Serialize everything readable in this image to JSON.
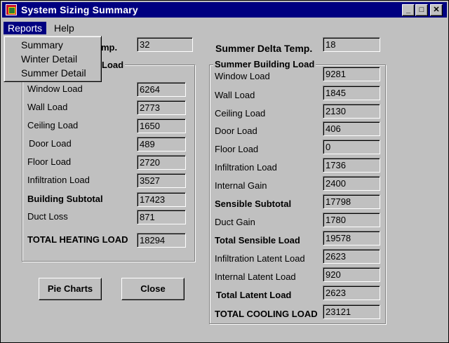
{
  "window": {
    "title": "System Sizing Summary",
    "min_glyph": "_",
    "max_glyph": "□",
    "close_glyph": "✕"
  },
  "menu": {
    "reports": "Reports",
    "help": "Help",
    "dropdown": [
      "Summary",
      "Winter Detail",
      "Summer Detail"
    ]
  },
  "winter": {
    "delta_label_visible": "mp.",
    "delta_value": "32",
    "group_title_visible": "Load",
    "rows": [
      {
        "label": "Window Load",
        "value": "6264",
        "bold": false
      },
      {
        "label": "Wall Load",
        "value": "2773",
        "bold": false
      },
      {
        "label": "Ceiling Load",
        "value": "1650",
        "bold": false
      },
      {
        "label": "Door Load",
        "value": "489",
        "bold": false
      },
      {
        "label": "Floor Load",
        "value": "2720",
        "bold": false
      },
      {
        "label": "Infiltration Load",
        "value": "3527",
        "bold": false
      },
      {
        "label": "Building Subtotal",
        "value": "17423",
        "bold": true
      },
      {
        "label": "Duct Loss",
        "value": "871",
        "bold": false
      },
      {
        "label": "TOTAL HEATING LOAD",
        "value": "18294",
        "bold": true
      }
    ]
  },
  "summer": {
    "delta_label": "Summer Delta Temp.",
    "delta_value": "18",
    "group_title": "Summer Building Load",
    "rows": [
      {
        "label": "Window Load",
        "value": "9281",
        "bold": false
      },
      {
        "label": "Wall Load",
        "value": "1845",
        "bold": false
      },
      {
        "label": "Ceiling Load",
        "value": "2130",
        "bold": false
      },
      {
        "label": "Door Load",
        "value": "406",
        "bold": false
      },
      {
        "label": "Floor Load",
        "value": "0",
        "bold": false
      },
      {
        "label": "Infiltration Load",
        "value": "1736",
        "bold": false
      },
      {
        "label": "Internal Gain",
        "value": "2400",
        "bold": false
      },
      {
        "label": "Sensible Subtotal",
        "value": "17798",
        "bold": true
      },
      {
        "label": "Duct Gain",
        "value": "1780",
        "bold": false
      },
      {
        "label": "Total Sensible Load",
        "value": "19578",
        "bold": true
      },
      {
        "label": "Infiltration Latent Load",
        "value": "2623",
        "bold": false
      },
      {
        "label": "Internal Latent Load",
        "value": "920",
        "bold": false
      },
      {
        "label": "Total Latent Load",
        "value": "2623",
        "bold": true
      },
      {
        "label": "TOTAL COOLING LOAD",
        "value": "23121",
        "bold": true
      }
    ]
  },
  "buttons": {
    "pie_charts": "Pie Charts",
    "close": "Close"
  }
}
